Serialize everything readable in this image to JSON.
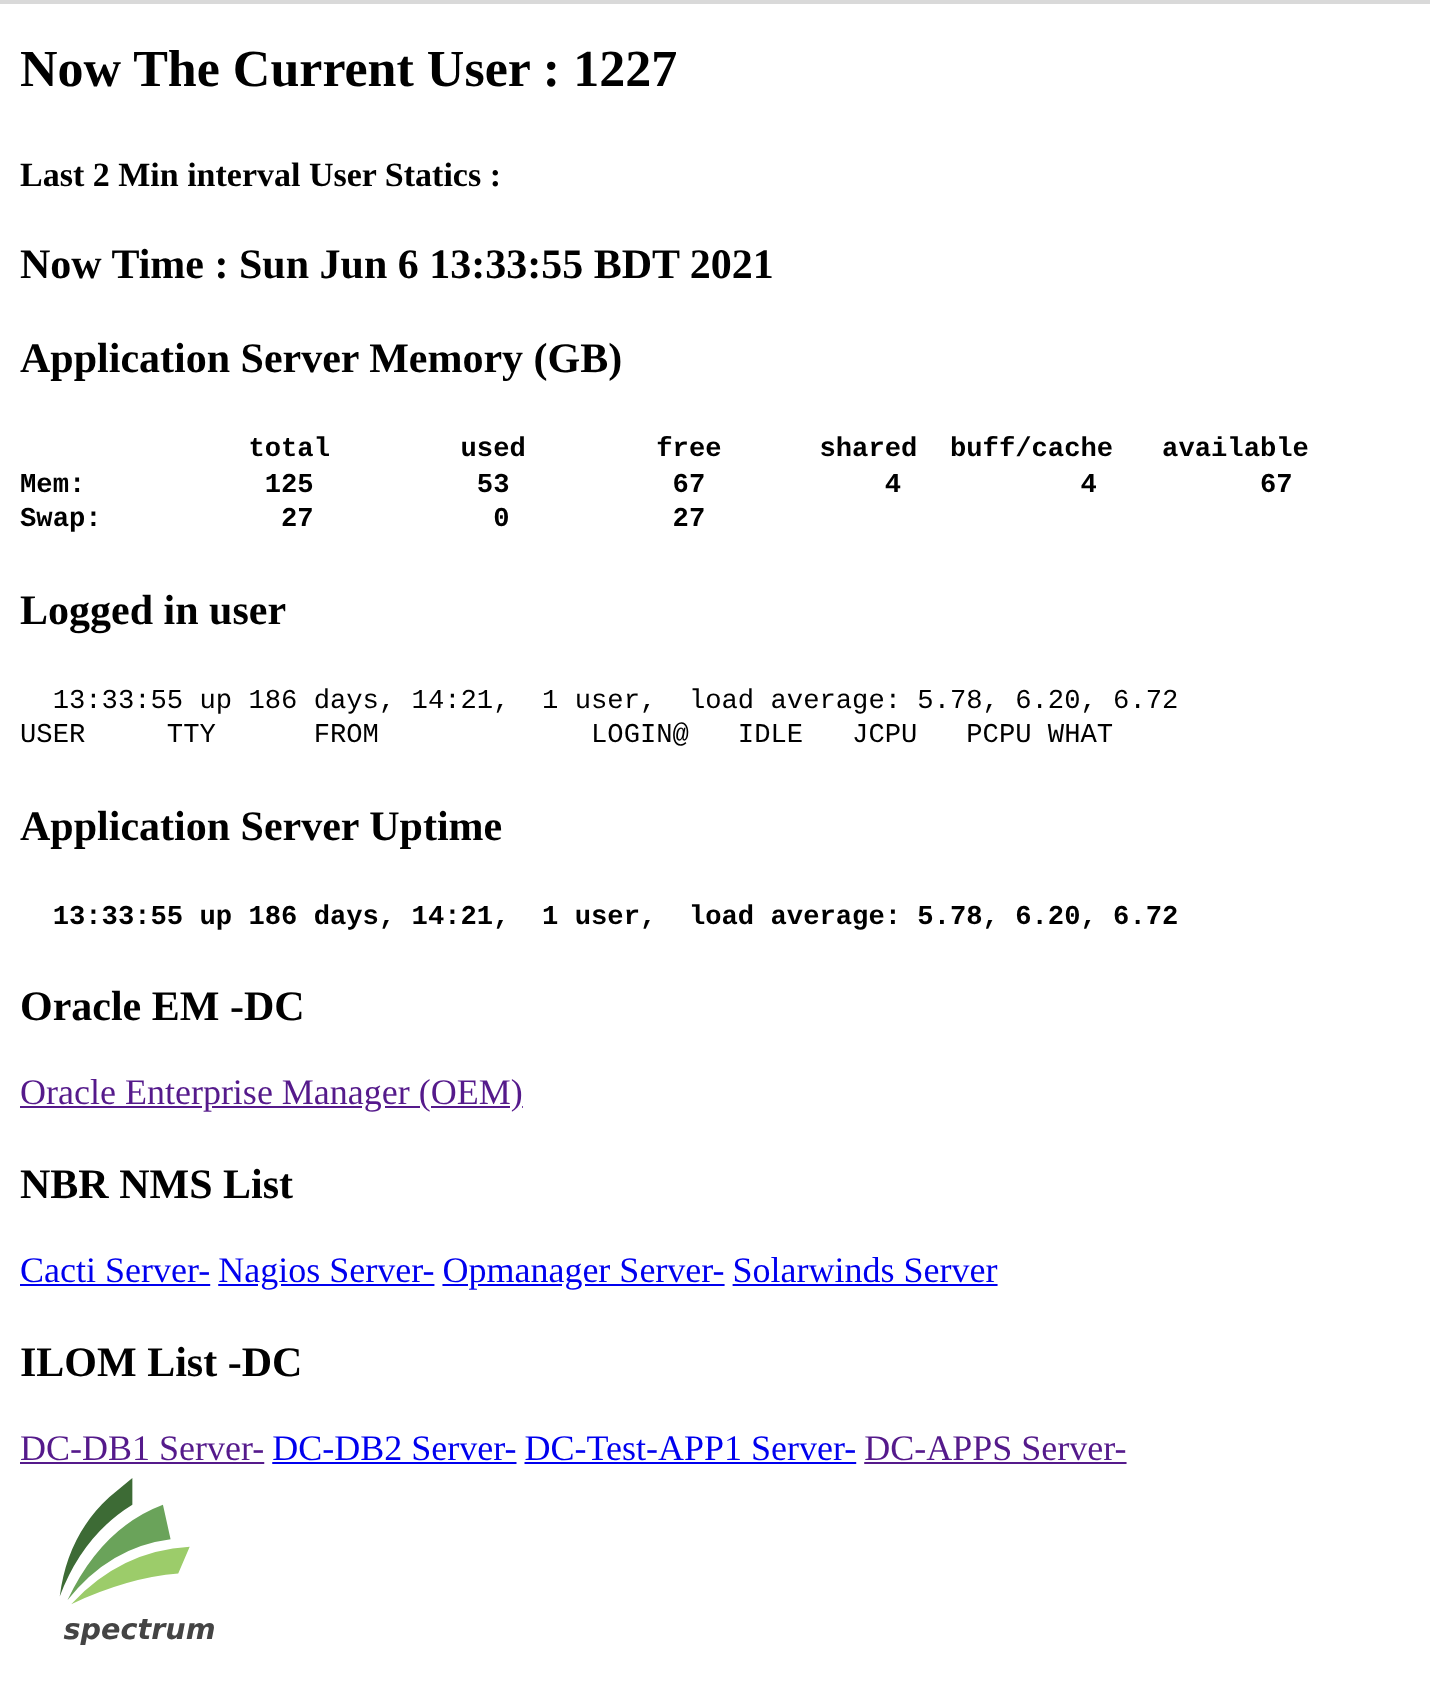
{
  "title": "Now The Current User : 1227",
  "subtitle": "Last 2 Min interval User Statics :",
  "time": "Now Time : Sun Jun 6 13:33:55 BDT 2021",
  "sections": [
    {
      "heading": "Application Server Memory (GB)",
      "kind": "pre",
      "bold": true,
      "lines": [
        "              total        used        free      shared  buff/cache   available",
        "Mem:           125          53          67           4           4          67",
        "Swap:           27           0          27"
      ]
    },
    {
      "heading": "Logged in user",
      "kind": "pre",
      "bold": false,
      "lines": [
        "  13:33:55 up 186 days, 14:21,  1 user,  load average: 5.78, 6.20, 6.72",
        "USER     TTY      FROM             LOGIN@   IDLE   JCPU   PCPU WHAT"
      ]
    },
    {
      "heading": "Application Server Uptime",
      "kind": "pre",
      "bold": true,
      "lines": [
        "  13:33:55 up 186 days, 14:21,  1 user,  load average: 5.78, 6.20, 6.72"
      ]
    },
    {
      "heading": "Oracle EM -DC",
      "kind": "links",
      "links": [
        {
          "label": "Oracle Enterprise Manager (OEM)",
          "visited": true
        }
      ]
    },
    {
      "heading": "NBR NMS List",
      "kind": "links",
      "links": [
        {
          "label": "Cacti Server-",
          "visited": false
        },
        {
          "label": "Nagios Server-",
          "visited": false
        },
        {
          "label": "Opmanager Server-",
          "visited": false
        },
        {
          "label": "Solarwinds Server",
          "visited": false
        }
      ]
    },
    {
      "heading": "ILOM List -DC",
      "kind": "links",
      "links": [
        {
          "label": "DC-DB1 Server-",
          "visited": true
        },
        {
          "label": "DC-DB2 Server-",
          "visited": false
        },
        {
          "label": "DC-Test-APP1 Server-",
          "visited": false
        },
        {
          "label": "DC-APPS Server-",
          "visited": true
        }
      ]
    }
  ],
  "logo": {
    "text": "spectrum"
  }
}
